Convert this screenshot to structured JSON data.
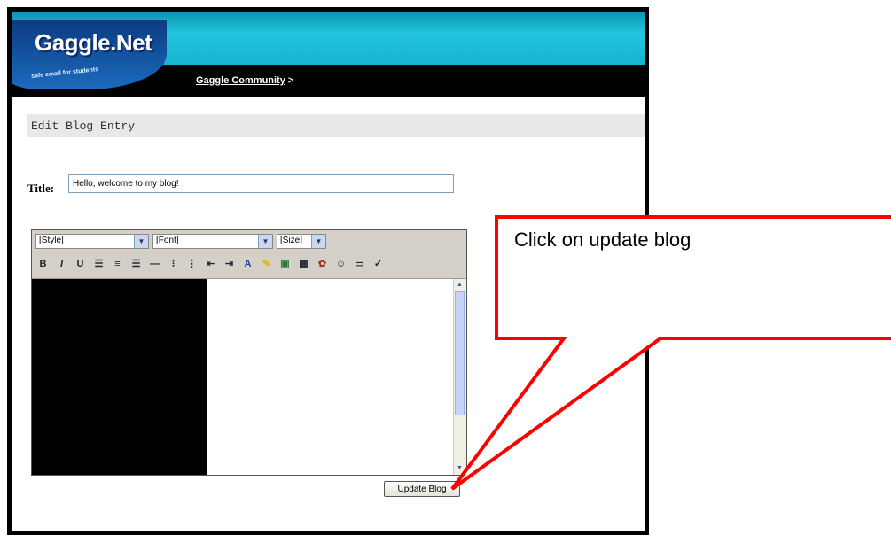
{
  "header": {
    "logo": "Gaggle.Net",
    "tagline": "safe email for students",
    "breadcrumb_link": "Gaggle Community",
    "breadcrumb_sep": " >"
  },
  "page": {
    "title": "Edit Blog Entry"
  },
  "form": {
    "title_label": "Title:",
    "title_value": "Hello, welcome to my blog!"
  },
  "editor": {
    "style_select": "[Style]",
    "font_select": "[Font]",
    "size_select": "[Size]",
    "toolbar_icons": [
      "bold-icon",
      "italic-icon",
      "underline-icon",
      "align-left-icon",
      "align-center-icon",
      "align-right-icon",
      "horizontal-rule-icon",
      "ordered-list-icon",
      "unordered-list-icon",
      "outdent-icon",
      "indent-icon",
      "font-color-icon",
      "highlight-icon",
      "insert-image-icon",
      "insert-table-icon",
      "insert-link-icon",
      "insert-smiley-icon",
      "fullscreen-icon",
      "spellcheck-icon"
    ]
  },
  "actions": {
    "update_label": "Update Blog"
  },
  "callout": {
    "text": "Click on update blog",
    "border_color": "#ff0000"
  },
  "colors": {
    "header_cyan": "#1ab8d4",
    "header_black": "#000000",
    "logo_blue": "#124f9e"
  }
}
